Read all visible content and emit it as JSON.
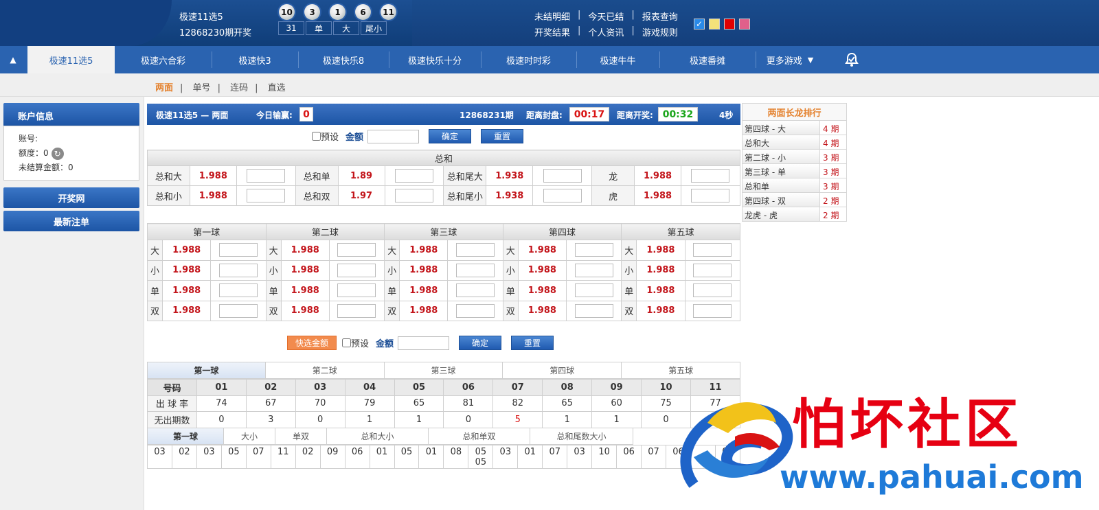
{
  "header": {
    "game_name": "极速11选5",
    "issue_text": "12868230期开奖",
    "balls": [
      "10",
      "3",
      "1",
      "6",
      "11"
    ],
    "stats": [
      "31",
      "单",
      "大",
      "尾小"
    ],
    "links_row1": [
      "未结明细",
      "今天已结",
      "报表查询"
    ],
    "links_row2": [
      "开奖结果",
      "个人资讯",
      "游戏规则"
    ],
    "swatch_colors": [
      "#2a8ae8",
      "#f4e27a",
      "#e00000",
      "#e0608a"
    ],
    "swatch_check": "✓"
  },
  "nav": {
    "items": [
      "极速11选5",
      "极速六合彩",
      "极速快3",
      "极速快乐8",
      "极速快乐十分",
      "极速时时彩",
      "极速牛牛",
      "极速番摊",
      "更多游戏"
    ],
    "more_arrow": "▼",
    "collapse_icon": "▲"
  },
  "subnav": {
    "items": [
      "两面",
      "单号",
      "连码",
      "直选"
    ],
    "sep": "|"
  },
  "sidebar": {
    "account_title": "账户信息",
    "account_label": "账号:",
    "credit_label": "额度：0",
    "unsettled_label": "未结算金额：0",
    "btn_lottery_site": "开奖网",
    "btn_latest_bets": "最新注单"
  },
  "main": {
    "title": "极速11选5 — 两面",
    "today_label": "今日输赢:",
    "today_value": "0",
    "issue": "12868231期",
    "close_label": "距离封盘:",
    "close_value": "00:17",
    "open_label": "距离开奖:",
    "open_value": "00:32",
    "seconds": "4秒",
    "preset_label": "预设",
    "amount_label": "金额",
    "confirm": "确定",
    "reset": "重置",
    "quick_amount": "快选金额"
  },
  "sum_table": {
    "title": "总和",
    "rows": [
      [
        [
          "总和大",
          "1.988"
        ],
        [
          "总和单",
          "1.89"
        ],
        [
          "总和尾大",
          "1.938"
        ],
        [
          "龙",
          "1.988"
        ]
      ],
      [
        [
          "总和小",
          "1.988"
        ],
        [
          "总和双",
          "1.97"
        ],
        [
          "总和尾小",
          "1.938"
        ],
        [
          "虎",
          "1.988"
        ]
      ]
    ]
  },
  "ball_table": {
    "headers": [
      "第一球",
      "第二球",
      "第三球",
      "第四球",
      "第五球"
    ],
    "labels": [
      "大",
      "小",
      "单",
      "双"
    ],
    "odds": "1.988"
  },
  "stats_tabs": [
    "第一球",
    "第二球",
    "第三球",
    "第四球",
    "第五球"
  ],
  "stats_table": {
    "row_labels": [
      "号码",
      "出 球 率",
      "无出期数"
    ],
    "numbers": [
      "01",
      "02",
      "03",
      "04",
      "05",
      "06",
      "07",
      "08",
      "09",
      "10",
      "11"
    ],
    "rates": [
      "74",
      "67",
      "70",
      "79",
      "65",
      "81",
      "82",
      "65",
      "60",
      "75",
      "77"
    ],
    "missing": [
      "0",
      "3",
      "0",
      "1",
      "1",
      "0",
      "5",
      "1",
      "1",
      "0",
      ""
    ]
  },
  "trend_tabs": [
    "第一球",
    "大小",
    "单双",
    "总和大小",
    "总和单双",
    "总和尾数大小"
  ],
  "trend_values": [
    "03",
    "02",
    "03",
    "05",
    "07",
    "11",
    "02",
    "09",
    "06",
    "01",
    "05",
    "01",
    "08",
    "05\n05",
    "03",
    "01",
    "07",
    "03",
    "10",
    "06",
    "07",
    "06",
    "",
    "05"
  ],
  "rank": {
    "title": "两面长龙排行",
    "rows": [
      [
        "第四球 - 大",
        "4 期"
      ],
      [
        "总和大",
        "4 期"
      ],
      [
        "第二球 - 小",
        "3 期"
      ],
      [
        "第三球 - 单",
        "3 期"
      ],
      [
        "总和单",
        "3 期"
      ],
      [
        "第四球 - 双",
        "2 期"
      ],
      [
        "龙虎 - 虎",
        "2 期"
      ]
    ]
  },
  "watermark": {
    "text": "怕坏社区",
    "url": "www.pahuai.com"
  }
}
